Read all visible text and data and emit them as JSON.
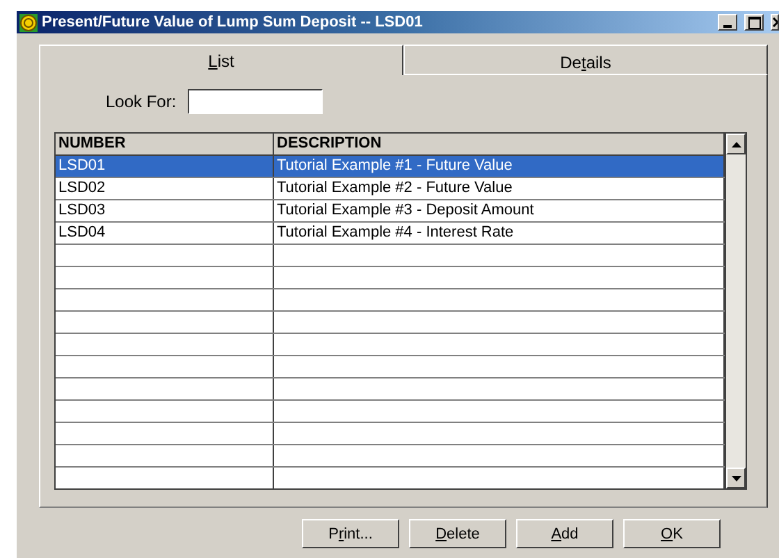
{
  "window": {
    "title": "Present/Future Value of Lump Sum Deposit -- LSD01"
  },
  "tabs": [
    {
      "key": "L",
      "post": "ist",
      "selected": true
    },
    {
      "pre": "De",
      "key": "t",
      "post": "ails",
      "selected": false
    }
  ],
  "search": {
    "label": "Look For:"
  },
  "table": {
    "columns": [
      "NUMBER",
      "DESCRIPTION"
    ],
    "rows": [
      {
        "cells": [
          "LSD01",
          "Tutorial Example #1 - Future Value"
        ],
        "selected": true
      },
      {
        "cells": [
          "LSD02",
          "Tutorial Example #2 - Future Value"
        ],
        "selected": false
      },
      {
        "cells": [
          "LSD03",
          "Tutorial Example #3 - Deposit Amount"
        ],
        "selected": false
      },
      {
        "cells": [
          "LSD04",
          "Tutorial Example #4 - Interest Rate"
        ],
        "selected": false
      }
    ]
  },
  "buttons": [
    {
      "pre": "P",
      "key": "r",
      "post": "int..."
    },
    {
      "key": "D",
      "post": "elete"
    },
    {
      "key": "A",
      "post": "dd"
    },
    {
      "key": "O",
      "post": "K"
    }
  ]
}
